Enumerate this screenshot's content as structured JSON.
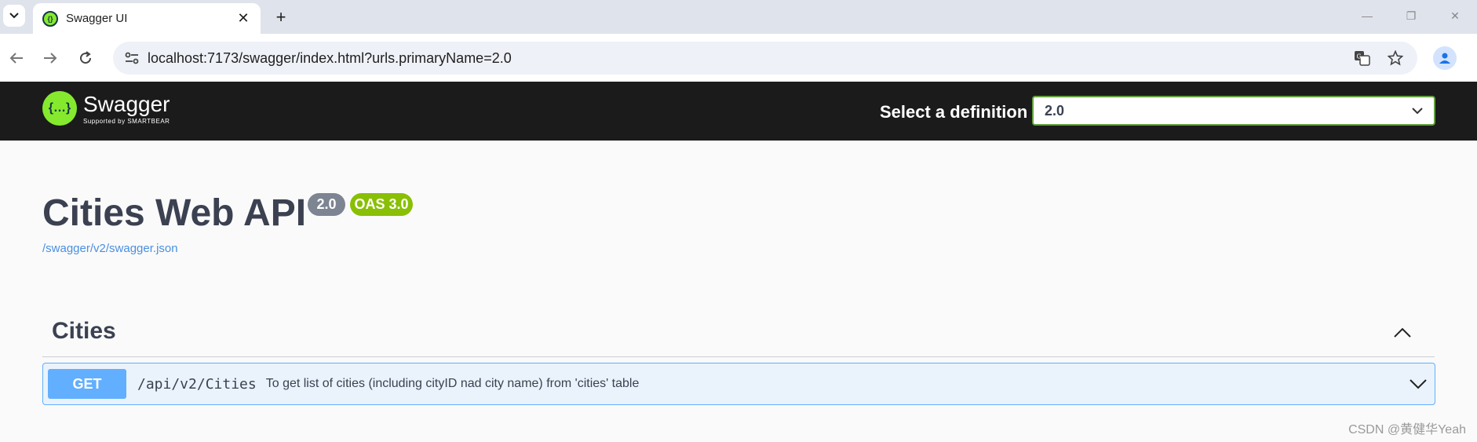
{
  "browser": {
    "tab_title": "Swagger UI",
    "url": "localhost:7173/swagger/index.html?urls.primaryName=2.0"
  },
  "topbar": {
    "logo_name": "Swagger",
    "logo_sub": "Supported by SMARTBEAR",
    "definition_label": "Select a definition",
    "definition_value": "2.0"
  },
  "info": {
    "title": "Cities Web API",
    "version_badge": "2.0",
    "oas_badge": "OAS 3.0",
    "spec_link": "/swagger/v2/swagger.json"
  },
  "tag": {
    "name": "Cities",
    "operations": [
      {
        "method": "GET",
        "path": "/api/v2/Cities",
        "summary": "To get list of cities (including cityID nad city name) from 'cities' table"
      }
    ]
  },
  "watermark": "CSDN @黄健华Yeah",
  "colors": {
    "topbar_bg": "#1b1b1b",
    "swagger_green": "#85ea2d",
    "get_blue": "#61affe",
    "get_bg": "#eaf3fc",
    "oas_green": "#89bf04",
    "version_gray": "#7d8492",
    "title_text": "#3b4151",
    "link_blue": "#4990e2"
  },
  "icons": [
    "tab-menu-icon",
    "swagger-favicon-icon",
    "close-icon",
    "plus-icon",
    "back-icon",
    "forward-icon",
    "reload-icon",
    "site-info-icon",
    "translate-icon",
    "star-icon",
    "profile-icon",
    "chevron-down-icon",
    "chevron-up-icon"
  ]
}
